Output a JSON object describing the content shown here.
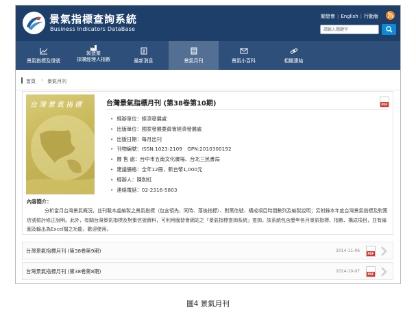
{
  "header": {
    "site_title_cn": "景氣指標查詢系統",
    "site_title_en": "Business Indicators DataBase",
    "links": [
      "關發會",
      "English",
      "行動版"
    ],
    "search_placeholder": "請輸入關鍵字"
  },
  "nav": {
    "items": [
      {
        "label": "景氣指標及燈號",
        "icon": "line-chart-icon"
      },
      {
        "label": "製造業\n採購經理人指數",
        "icon": "factory-icon"
      },
      {
        "label": "最新消息",
        "icon": "news-icon"
      },
      {
        "label": "景氣月刊",
        "icon": "book-icon",
        "active": true
      },
      {
        "label": "景氣小百科",
        "icon": "mail-icon"
      },
      {
        "label": "相關連結",
        "icon": "link-icon"
      }
    ]
  },
  "breadcrumb": {
    "home": "首頁",
    "current": "景氣月刊"
  },
  "featured": {
    "title": "台灣景氣指標月刊 (第38卷第10期)",
    "cover_text": "台灣景氣指標",
    "info": [
      "經辦單位：經濟發展處",
      "出版單位：國家發展委員會經濟發展處",
      "出版日期：每月出刊",
      "刊物編號：ISSN:1023-2109　GPN:2010300192",
      "展 售 處：台中市五南文化廣場、台北三民書局",
      "建議價格：全年12冊，新台幣1,000元",
      "經辦人：陳劍虹",
      "連絡電話：02-2316-5803"
    ],
    "intro_heading": "內容簡介：",
    "intro_text": "分析當月台灣景氣概況，並刊載本處編製之景氣指標（包含領先、同時、落後指標）、對策信號、構成項目時間數列及編製說明；另附錄本年度台灣景氣指標及對策信號檢討修正說明。此外，有關台灣景氣指標及對策信號資料，可利用國發會網站之「景氣指標查詢系統」查詢，該系統包含歷年各月景氣指標、指數、構成項目，並有繪圖及輸出為Excel檔之功能，歡迎使用。"
  },
  "issues": [
    {
      "title": "台灣景氣指標月刊 (第38卷第9期)",
      "date": "2014-11-06"
    },
    {
      "title": "台灣景氣指標月刊 (第38卷第8期)",
      "date": "2014-10-07"
    }
  ],
  "pdf_label": "PDF",
  "caption": "圖4 景氣月刊",
  "colors": {
    "header_bg": "#1d3f69",
    "nav_bg": "#2d4f79",
    "nav_active": "#536f94",
    "search_btn": "#0d8ad6",
    "rss": "#f3851f",
    "pdf_red": "#d9342b"
  }
}
